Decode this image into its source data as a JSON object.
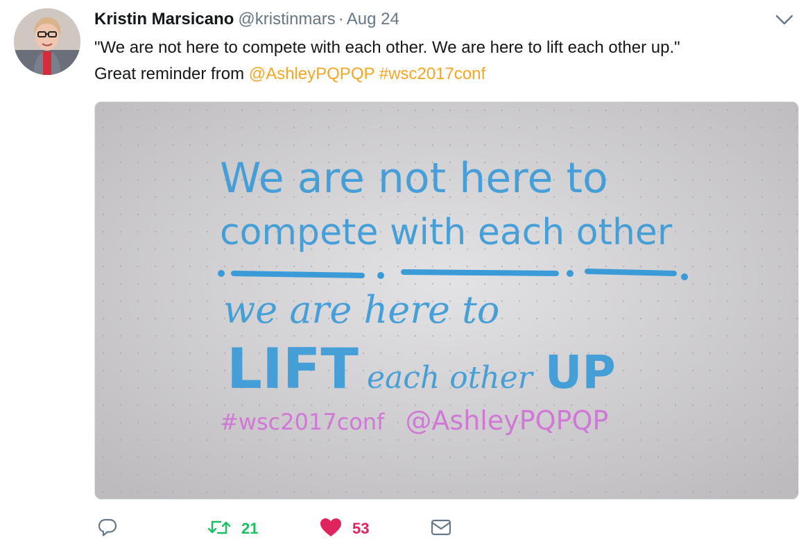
{
  "tweet": {
    "author_name": "Kristin Marsicano",
    "author_handle": "@kristinmars",
    "separator": "·",
    "date": "Aug 24",
    "text_line1": "\"We are not here to compete with each other. We are here to lift each other up.\"",
    "text_line2_prefix": "Great reminder from ",
    "mention": "@AshleyPQPQP",
    "hashtag": "#wsc2017conf",
    "image_text": {
      "line1": "We are not here to",
      "line2": "compete with each other",
      "line3": "we are here to",
      "line4_big": "LIFT",
      "line4_mid": "each other",
      "line4_end": "UP",
      "line5_tag": "#wsc2017conf",
      "line5_mention": "@AshleyPQPQP"
    }
  },
  "actions": {
    "reply_count": "",
    "retweet_count": "21",
    "like_count": "53"
  },
  "icons": {
    "caret": "chevron-down-icon",
    "reply": "reply-icon",
    "retweet": "retweet-icon",
    "like": "heart-icon",
    "dm": "envelope-icon"
  },
  "colors": {
    "link": "#f5a623",
    "retweet": "#17bf63",
    "like": "#e0245e",
    "muted": "#657786",
    "marker_blue": "#3a9bd8",
    "marker_pink": "#d26fd8"
  }
}
